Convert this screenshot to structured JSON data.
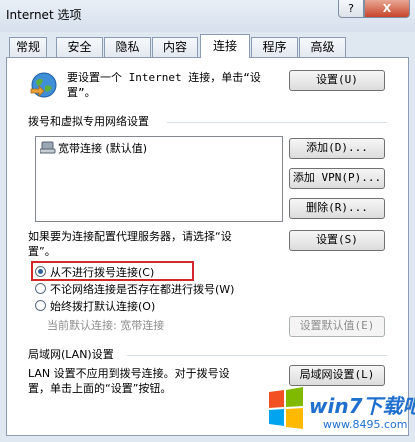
{
  "window": {
    "title": "Internet 选项",
    "help_glyph": "?",
    "close_glyph": "X"
  },
  "tabs": [
    {
      "label": "常规"
    },
    {
      "label": "安全"
    },
    {
      "label": "隐私"
    },
    {
      "label": "内容"
    },
    {
      "label": "连接",
      "active": true
    },
    {
      "label": "程序"
    },
    {
      "label": "高级"
    }
  ],
  "setup": {
    "text_line1": "要设置一个 Internet 连接，单击“设",
    "text_line2": "置”。",
    "button": "设置(U)"
  },
  "dialup": {
    "heading": "拨号和虚拟专用网络设置",
    "connections": [
      "宽带连接 (默认值)"
    ],
    "add_button": "添加(D)...",
    "add_vpn_button": "添加 VPN(P)...",
    "delete_button": "删除(R)...",
    "proxy_text_line1": "如果要为连接配置代理服务器，请选择“设",
    "proxy_text_line2": "置”。",
    "settings_button": "设置(S)",
    "options": [
      {
        "label": "从不进行拨号连接(C)",
        "checked": true
      },
      {
        "label": "不论网络连接是否存在都进行拨号(W)",
        "checked": false
      },
      {
        "label": "始终拨打默认连接(O)",
        "checked": false
      }
    ],
    "current_default_label": "当前默认连接:",
    "current_default_value": "宽带连接",
    "set_default_button": "设置默认值(E)"
  },
  "lan": {
    "heading": "局域网(LAN)设置",
    "text_line1": "LAN 设置不应用到拨号连接。对于拨号设",
    "text_line2": "置，单击上面的“设置”按钮。",
    "button": "局域网设置(L)"
  },
  "watermark": {
    "brand": "win7下载吧",
    "url": "www.8495.com"
  },
  "colors": {
    "highlight_border": "#d2282a",
    "watermark_blue": "#1f6fcf"
  }
}
